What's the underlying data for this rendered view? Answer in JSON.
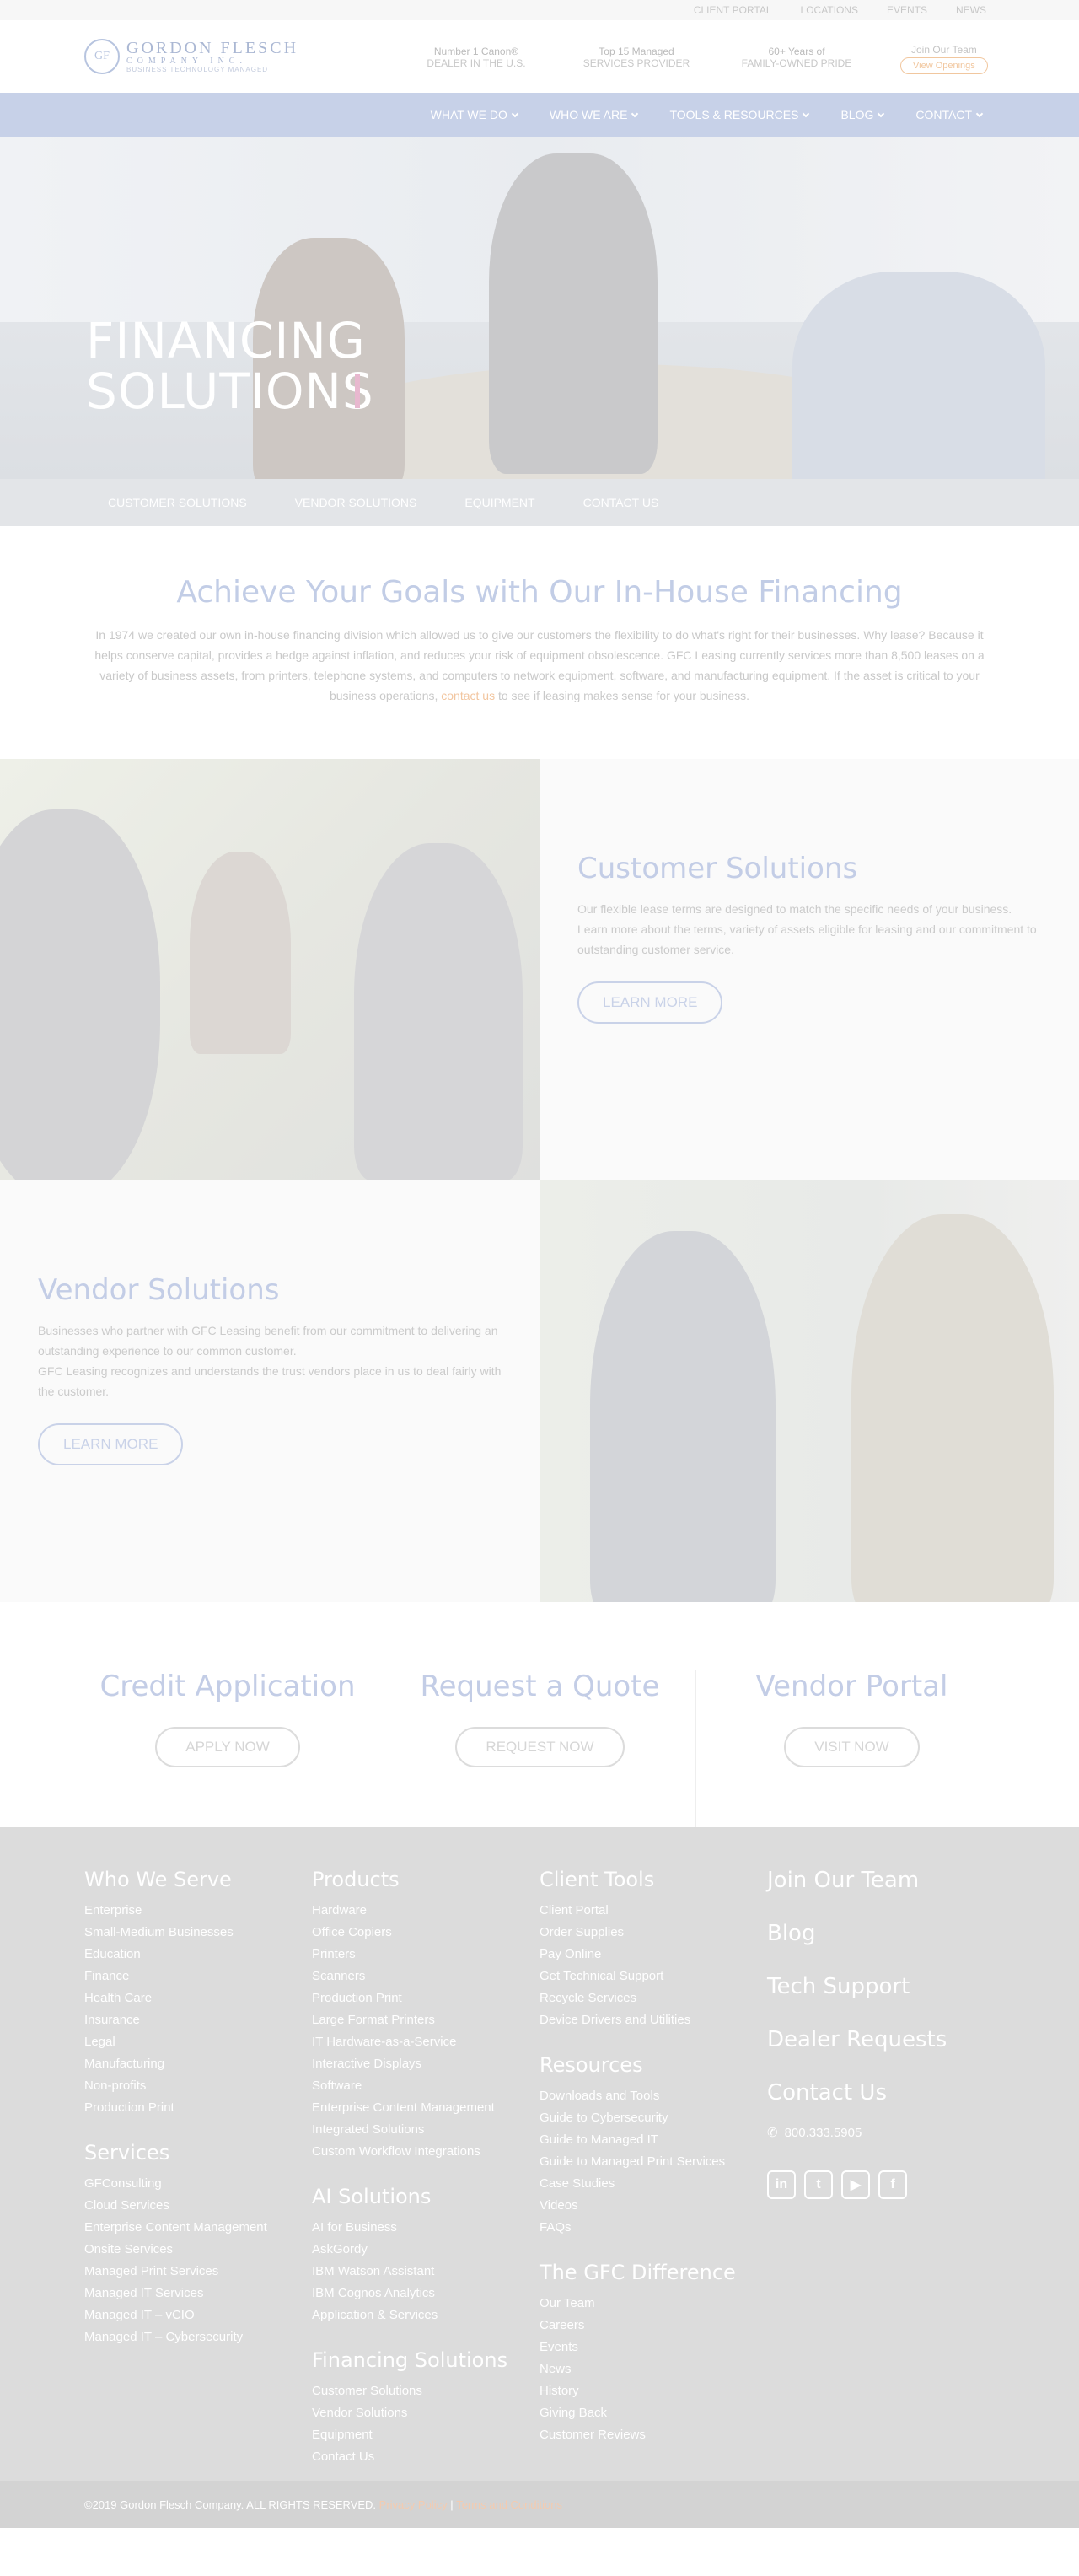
{
  "utility": {
    "links": [
      "CLIENT PORTAL",
      "LOCATIONS",
      "EVENTS",
      "NEWS"
    ]
  },
  "header": {
    "logo": {
      "name": "GORDON FLESCH",
      "sub": "COMPANY INC.",
      "tagline": "BUSINESS TECHNOLOGY MANAGED"
    },
    "stats": [
      {
        "top": "Number 1 Canon®",
        "bottom": "DEALER IN THE U.S."
      },
      {
        "top": "Top 15 Managed",
        "bottom": "SERVICES PROVIDER"
      },
      {
        "top": "60+ Years of",
        "bottom": "FAMILY-OWNED PRIDE"
      }
    ],
    "join": {
      "title": "Join Our Team",
      "button": "View Openings"
    }
  },
  "nav": {
    "items": [
      "WHAT WE DO",
      "WHO WE ARE",
      "TOOLS & RESOURCES",
      "BLOG",
      "CONTACT"
    ]
  },
  "hero": {
    "title_line1": "FINANCING",
    "title_line2": "SOLUTIONS"
  },
  "subnav": {
    "items": [
      "CUSTOMER SOLUTIONS",
      "VENDOR SOLUTIONS",
      "EQUIPMENT",
      "CONTACT US"
    ]
  },
  "intro": {
    "title": "Achieve Your Goals with Our In-House Financing",
    "body_before": "In 1974 we created our own in-house financing division which allowed us to give our customers the flexibility to do what's right for their businesses. Why lease? Because it helps conserve capital, provides a hedge against inflation, and reduces your risk of equipment obsolescence. GFC Leasing currently services more than 8,500 leases on a variety of business assets, from printers, telephone systems, and computers to network equipment, software, and manufacturing equipment. If the asset is critical to your business operations,",
    "link": "contact us",
    "body_after": "to see if leasing makes sense for your business."
  },
  "customer": {
    "title": "Customer Solutions",
    "body": "Our flexible lease terms are designed to match the specific needs of your business. Learn more about the terms, variety of assets eligible for leasing and our commitment to outstanding customer service.",
    "button": "LEARN MORE"
  },
  "vendor": {
    "title": "Vendor Solutions",
    "body1": "Businesses who partner with GFC Leasing benefit from our commitment to delivering an outstanding experience to our common customer.",
    "body2": "GFC Leasing recognizes and understands the trust vendors place in us to deal fairly with the customer.",
    "button": "LEARN MORE"
  },
  "cta": [
    {
      "title": "Credit Application",
      "button": "APPLY NOW"
    },
    {
      "title": "Request a Quote",
      "button": "REQUEST NOW"
    },
    {
      "title": "Vendor Portal",
      "button": "VISIT NOW"
    }
  ],
  "footer": {
    "who_we_serve": {
      "title": "Who We Serve",
      "items": [
        "Enterprise",
        "Small-Medium Businesses",
        "Education",
        "Finance",
        "Health Care",
        "Insurance",
        "Legal",
        "Manufacturing",
        "Non-profits",
        "Production Print"
      ]
    },
    "services": {
      "title": "Services",
      "items": [
        "GFConsulting",
        "Cloud Services",
        "Enterprise Content Management",
        "Onsite Services",
        "Managed Print Services",
        "Managed IT Services",
        "Managed IT – vCIO",
        "Managed IT – Cybersecurity"
      ]
    },
    "products": {
      "title": "Products",
      "items": [
        "Hardware",
        "Office Copiers",
        "Printers",
        "Scanners",
        "Production Print",
        "Large Format Printers",
        "IT Hardware-as-a-Service",
        "Interactive Displays",
        "Software",
        "Enterprise Content Management",
        "Integrated Solutions",
        "Custom Workflow Integrations"
      ]
    },
    "ai": {
      "title": "AI Solutions",
      "items": [
        "AI for Business",
        "AskGordy",
        "IBM Watson Assistant",
        "IBM Cognos Analytics",
        "Application & Services"
      ]
    },
    "financing": {
      "title": "Financing Solutions",
      "items": [
        "Customer Solutions",
        "Vendor Solutions",
        "Equipment",
        "Contact Us"
      ]
    },
    "client_tools": {
      "title": "Client Tools",
      "items": [
        "Client Portal",
        "Order Supplies",
        "Pay Online",
        "Get Technical Support",
        "Recycle Services",
        "Device Drivers and Utilities"
      ]
    },
    "resources": {
      "title": "Resources",
      "items": [
        "Downloads and Tools",
        "Guide to Cybersecurity",
        "Guide to Managed IT",
        "Guide to Managed Print Services",
        "Case Studies",
        "Videos",
        "FAQs"
      ]
    },
    "gfc_difference": {
      "title": "The GFC Difference",
      "items": [
        "Our Team",
        "Careers",
        "Events",
        "News",
        "History",
        "Giving Back",
        "Customer Reviews"
      ]
    },
    "right": {
      "join": "Join Our Team",
      "blog": "Blog",
      "tech": "Tech Support",
      "dealer": "Dealer Requests",
      "contact": "Contact Us",
      "phone": "800.333.5905"
    },
    "social": [
      "linkedin-icon",
      "twitter-icon",
      "youtube-icon",
      "facebook-icon"
    ],
    "copyright": "©2019 Gordon Flesch Company. ALL RIGHTS RESERVED.",
    "privacy": "Privacy Policy",
    "terms": "Terms and Conditions",
    "separator": "|"
  }
}
